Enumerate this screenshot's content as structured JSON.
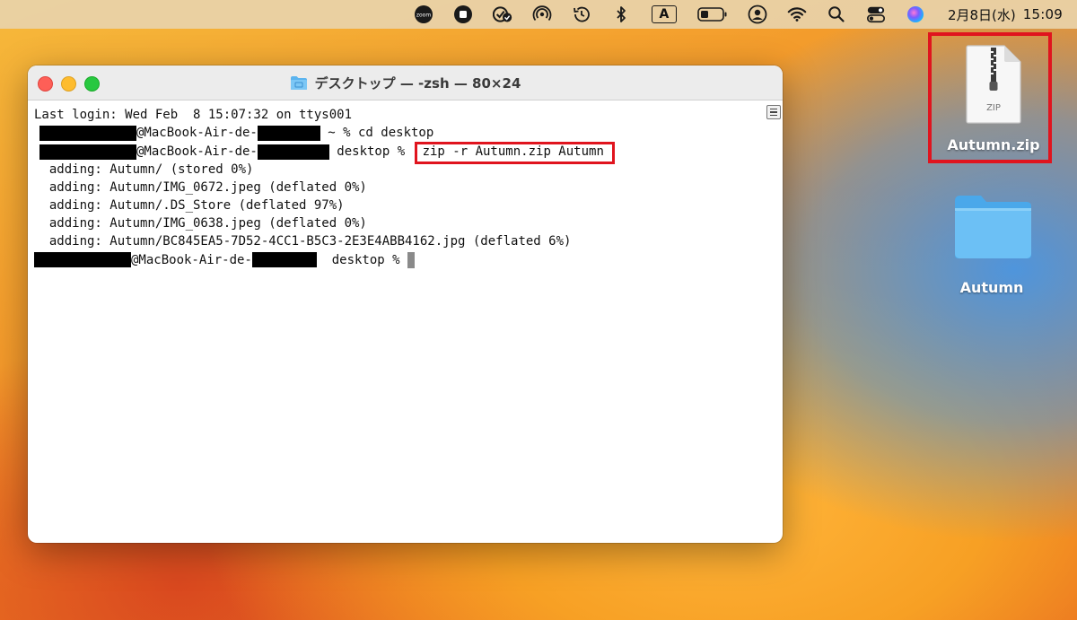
{
  "menubar": {
    "icons": [
      "zoom-icon",
      "stop-record-icon",
      "task-check-icon",
      "airdrop-icon",
      "time-machine-icon",
      "bluetooth-icon",
      "input-source-icon",
      "battery-icon",
      "user-icon",
      "wifi-icon",
      "search-icon",
      "control-center-icon",
      "siri-icon"
    ],
    "input_source_label": "A",
    "zoom_label": "zoom",
    "date": "2月8日(水)",
    "time": "15:09"
  },
  "terminal": {
    "title": "デスクトップ — -zsh — 80×24",
    "lines": {
      "l1": "Last login: Wed Feb  8 15:07:32 on ttys001",
      "l2_host": "@MacBook-Air-de-",
      "l2_cmd": " ~ % cd desktop",
      "l3_host": "@MacBook-Air-de-",
      "l3_prompt": " desktop % ",
      "l3_cmd": "zip -r Autumn.zip Autumn",
      "l4": "  adding: Autumn/ (stored 0%)",
      "l5": "  adding: Autumn/IMG_0672.jpeg (deflated 0%)",
      "l6": "  adding: Autumn/.DS_Store (deflated 97%)",
      "l7": "  adding: Autumn/IMG_0638.jpeg (deflated 0%)",
      "l8": "  adding: Autumn/BC845EA5-7D52-4CC1-B5C3-2E3E4ABB4162.jpg (deflated 6%)",
      "l9_host": "@MacBook-Air-de-",
      "l9_prompt": "  desktop % "
    }
  },
  "desktop": {
    "zip_label": "Autumn.zip",
    "zip_badge": "ZIP",
    "folder_label": "Autumn"
  },
  "colors": {
    "highlight": "#e0141e",
    "folder": "#5bb4ef"
  }
}
